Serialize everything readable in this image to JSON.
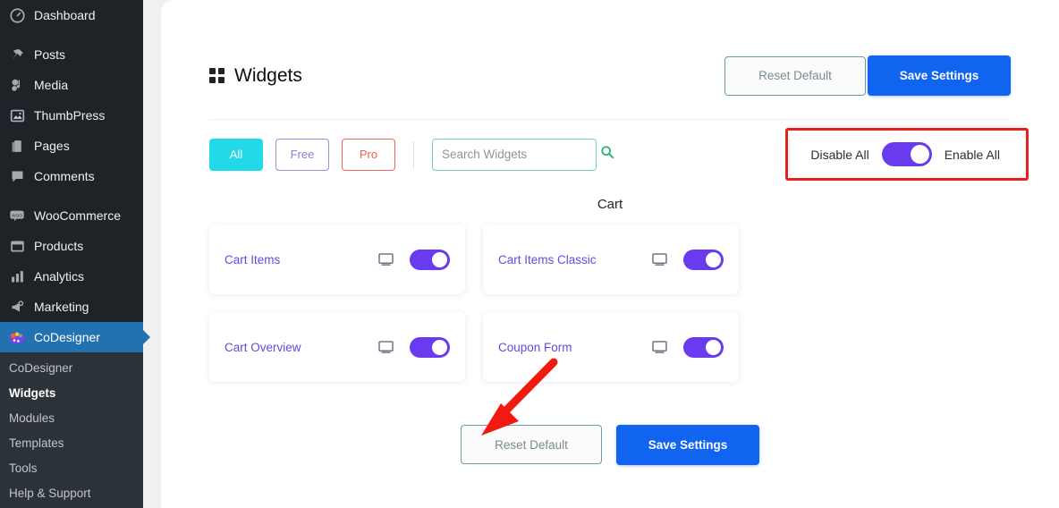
{
  "sidebar": {
    "items": [
      {
        "label": "Dashboard",
        "icon": "dashboard-icon"
      },
      {
        "label": "Posts",
        "icon": "pin-icon"
      },
      {
        "label": "Media",
        "icon": "media-icon"
      },
      {
        "label": "ThumbPress",
        "icon": "image-icon"
      },
      {
        "label": "Pages",
        "icon": "pages-icon"
      },
      {
        "label": "Comments",
        "icon": "comment-icon"
      },
      {
        "label": "WooCommerce",
        "icon": "woo-icon"
      },
      {
        "label": "Products",
        "icon": "products-icon"
      },
      {
        "label": "Analytics",
        "icon": "analytics-icon"
      },
      {
        "label": "Marketing",
        "icon": "megaphone-icon"
      },
      {
        "label": "CoDesigner",
        "icon": "palette-icon"
      }
    ],
    "submenu": [
      {
        "label": "CoDesigner",
        "current": false
      },
      {
        "label": "Widgets",
        "current": true
      },
      {
        "label": "Modules",
        "current": false
      },
      {
        "label": "Templates",
        "current": false
      },
      {
        "label": "Tools",
        "current": false
      },
      {
        "label": "Help & Support",
        "current": false
      }
    ],
    "active_color": "#2271b1"
  },
  "header": {
    "title": "Widgets",
    "icon": "grid-icon",
    "reset_label": "Reset Default",
    "save_label": "Save Settings"
  },
  "filters": {
    "tabs": [
      {
        "label": "All",
        "state": "active",
        "color": "#21d9e8"
      },
      {
        "label": "Free",
        "state": "inactive",
        "color": "#9b8cdc"
      },
      {
        "label": "Pro",
        "state": "inactive",
        "color": "#f0685a"
      }
    ],
    "search": {
      "placeholder": "Search Widgets",
      "value": "",
      "icon": "search-icon",
      "border_color": "#7bd1a8"
    }
  },
  "bulk_toggle": {
    "disable_label": "Disable All",
    "enable_label": "Enable All",
    "enabled": true,
    "toggle_color": "#6a3aee",
    "highlight_color": "#e8201b"
  },
  "section": {
    "title": "Cart",
    "widgets": [
      {
        "name": "Cart Items",
        "device_icon": "monitor-icon",
        "enabled": true
      },
      {
        "name": "Cart Items Classic",
        "device_icon": "monitor-icon",
        "enabled": true
      },
      {
        "name": "Cart Overview",
        "device_icon": "monitor-icon",
        "enabled": true
      },
      {
        "name": "Coupon Form",
        "device_icon": "monitor-icon",
        "enabled": true
      }
    ]
  },
  "footer": {
    "reset_label": "Reset Default",
    "save_label": "Save Settings",
    "annotation_arrow": {
      "color": "#f01a10",
      "points_to": "save-settings-button"
    }
  }
}
